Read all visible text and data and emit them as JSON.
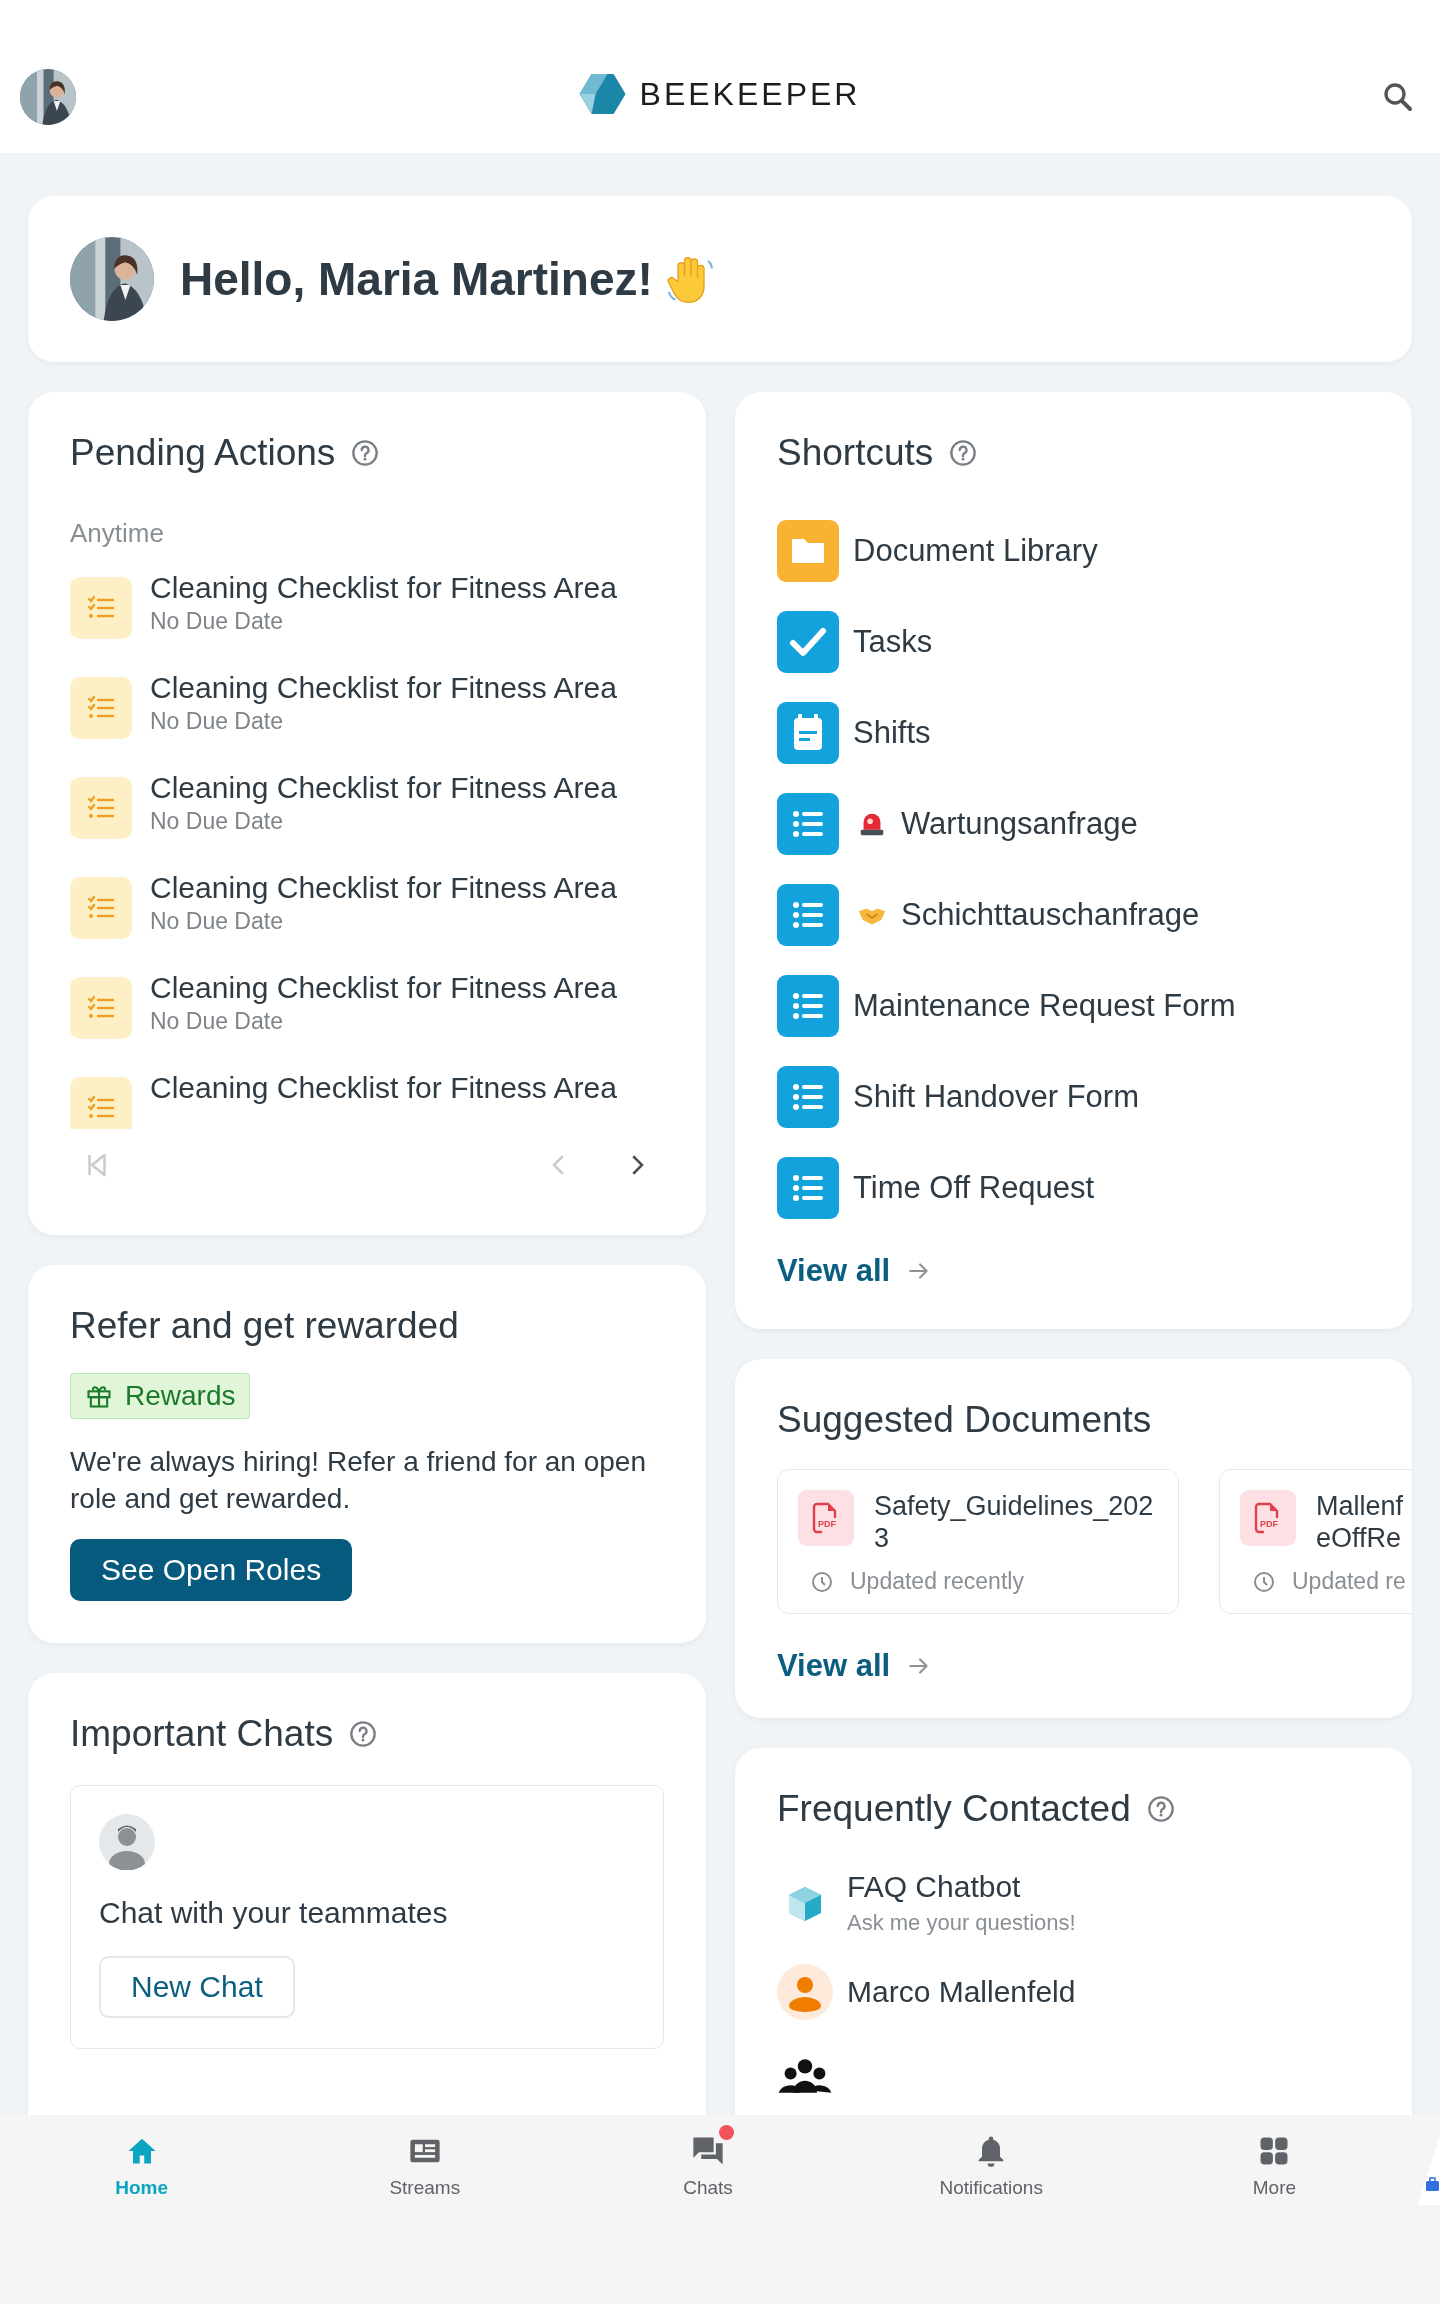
{
  "header": {
    "brand": "BEEKEEPER"
  },
  "greeting": {
    "text": "Hello, Maria Martinez!"
  },
  "pending_actions": {
    "title": "Pending Actions",
    "group": "Anytime",
    "items": [
      {
        "title": "Cleaning Checklist for Fitness Area",
        "due": "No Due Date"
      },
      {
        "title": "Cleaning Checklist for Fitness Area",
        "due": "No Due Date"
      },
      {
        "title": "Cleaning Checklist for Fitness Area",
        "due": "No Due Date"
      },
      {
        "title": "Cleaning Checklist for Fitness Area",
        "due": "No Due Date"
      },
      {
        "title": "Cleaning Checklist for Fitness Area",
        "due": "No Due Date"
      },
      {
        "title": "Cleaning Checklist for Fitness Area"
      }
    ],
    "pagination": {
      "first_disabled": true,
      "prev_disabled": true,
      "next_disabled": false
    }
  },
  "referral": {
    "title": "Refer and get rewarded",
    "tag": "Rewards",
    "text": "We're always hiring! Refer a friend for an open role and get rewarded.",
    "button": "See Open Roles"
  },
  "important_chats": {
    "title": "Important Chats",
    "empty_text": "Chat with your teammates",
    "button": "New Chat"
  },
  "shortcuts": {
    "title": "Shortcuts",
    "items": [
      {
        "kind": "folder",
        "label": "Document Library"
      },
      {
        "kind": "tasks",
        "label": "Tasks"
      },
      {
        "kind": "shifts",
        "label": "Shifts"
      },
      {
        "kind": "alert",
        "label": "Wartungsanfrage"
      },
      {
        "kind": "swap",
        "label": "Schichttauschanfrage"
      },
      {
        "kind": "form",
        "label": "Maintenance Request Form"
      },
      {
        "kind": "form",
        "label": "Shift Handover Form"
      },
      {
        "kind": "form",
        "label": "Time Off Request"
      }
    ],
    "view_all": "View all"
  },
  "suggested_documents": {
    "title": "Suggested Documents",
    "documents": [
      {
        "file_type": "PDF",
        "title_lines": [
          "Safety_Guidelines_202",
          "3"
        ],
        "updated": "Updated recently"
      },
      {
        "file_type": "PDF",
        "title_lines": [
          "Mallenf",
          "eOffRe"
        ],
        "updated": "Updated re"
      }
    ],
    "view_all": "View all"
  },
  "frequently_contacted": {
    "title": "Frequently Contacted",
    "contacts": [
      {
        "kind": "bot",
        "name": "FAQ Chatbot",
        "subtitle": "Ask me your questions!"
      },
      {
        "kind": "person",
        "name": "Marco Mallenfeld"
      },
      {
        "kind": "group"
      }
    ]
  },
  "bottom_nav": [
    {
      "label": "Home",
      "selected": true,
      "unread": false
    },
    {
      "label": "Streams",
      "selected": false,
      "unread": false
    },
    {
      "label": "Chats",
      "selected": false,
      "unread": true
    },
    {
      "label": "Notifications",
      "selected": false,
      "unread": false
    },
    {
      "label": "More",
      "selected": false,
      "unread": false
    }
  ]
}
